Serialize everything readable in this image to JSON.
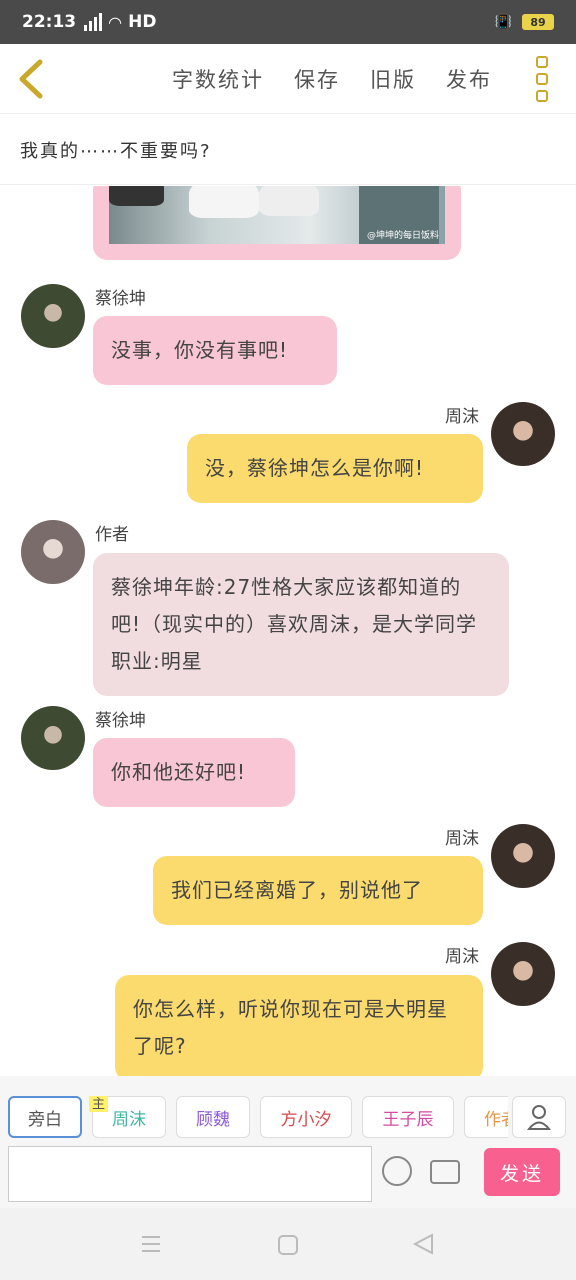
{
  "status": {
    "time": "22:13",
    "network": "4G",
    "hd": "HD",
    "battery": "89"
  },
  "toolbar": {
    "items": [
      "字数统计",
      "保存",
      "旧版",
      "发布"
    ]
  },
  "story": {
    "title": "我真的⋯⋯不重要吗?"
  },
  "image_card": {
    "watermark": "@坤坤的每日饭料"
  },
  "messages": [
    {
      "speaker": "蔡徐坤",
      "text": "没事，你没有事吧!"
    },
    {
      "speaker": "周沫",
      "text": "没，蔡徐坤怎么是你啊!"
    },
    {
      "speaker": "作者",
      "text": "蔡徐坤年龄:27性格大家应该都知道的吧!（现实中的）喜欢周沫，是大学同学职业:明星"
    },
    {
      "speaker": "蔡徐坤",
      "text": "你和他还好吧!"
    },
    {
      "speaker": "周沫",
      "text": "我们已经离婚了，别说他了"
    },
    {
      "speaker": "周沫",
      "text": "你怎么样，听说你现在可是大明星了呢?"
    }
  ],
  "characters": [
    {
      "label": "旁白",
      "color": "#555555",
      "active": true
    },
    {
      "label": "周沫",
      "color": "#3fb6a8",
      "tag": "主"
    },
    {
      "label": "顾魏",
      "color": "#8a5bd6"
    },
    {
      "label": "方小汐",
      "color": "#d64a4a"
    },
    {
      "label": "王子辰",
      "color": "#d64aa0"
    },
    {
      "label": "作者",
      "color": "#e8954a"
    }
  ],
  "composer": {
    "send_label": "发送"
  }
}
